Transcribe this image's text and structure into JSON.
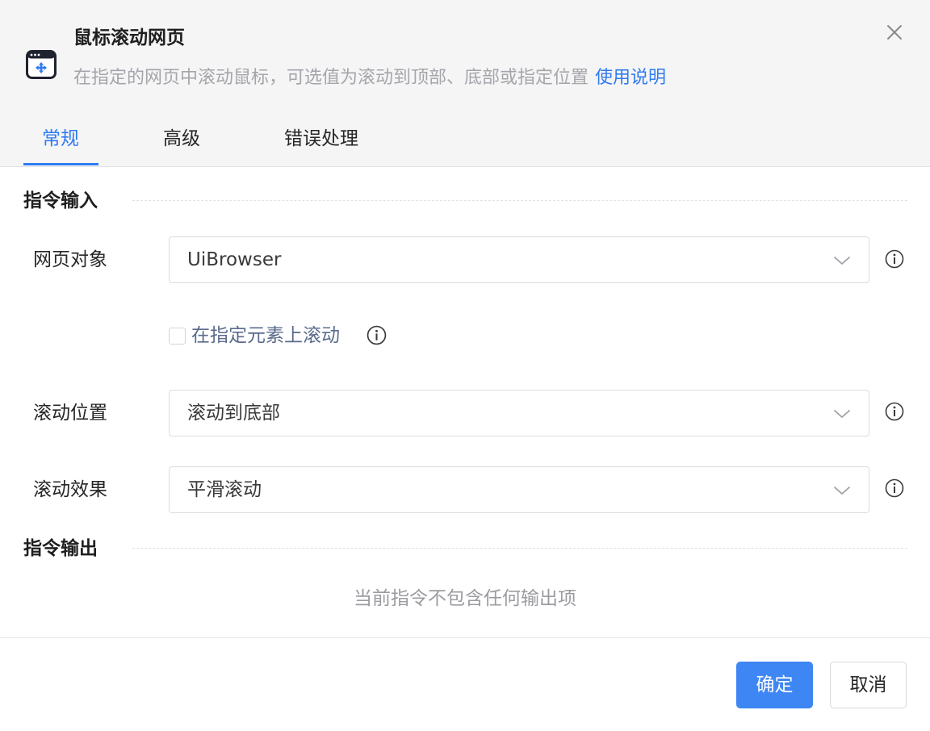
{
  "header": {
    "title": "鼠标滚动网页",
    "subtitle": "在指定的网页中滚动鼠标，可选值为滚动到顶部、底部或指定位置",
    "help_link": "使用说明",
    "icon": "browser-scroll-icon",
    "close_icon": "close-icon"
  },
  "tabs": [
    {
      "label": "常规",
      "active": true
    },
    {
      "label": "高级",
      "active": false
    },
    {
      "label": "错误处理",
      "active": false
    }
  ],
  "input_section": {
    "title": "指令输入",
    "fields": {
      "browser_object": {
        "label": "网页对象",
        "value": "UiBrowser"
      },
      "scroll_on_element": {
        "label": "在指定元素上滚动",
        "checked": false
      },
      "scroll_position": {
        "label": "滚动位置",
        "value": "滚动到底部"
      },
      "scroll_effect": {
        "label": "滚动效果",
        "value": "平滑滚动"
      }
    }
  },
  "output_section": {
    "title": "指令输出",
    "empty_text": "当前指令不包含任何输出项"
  },
  "footer": {
    "confirm_label": "确定",
    "cancel_label": "取消"
  },
  "colors": {
    "accent": "#2f7bf0",
    "primary_button": "#3d86f4",
    "header_bg": "#f5f5f6"
  }
}
